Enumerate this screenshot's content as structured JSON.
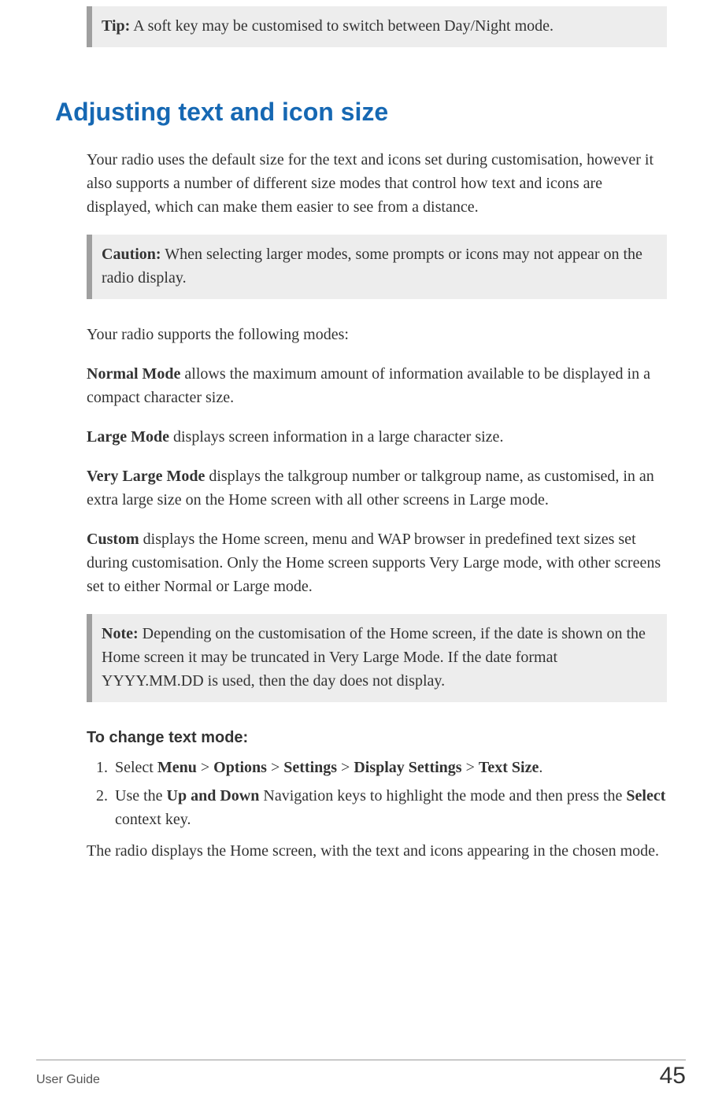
{
  "tip": {
    "label": "Tip:",
    "text": "A soft key may be customised to switch between Day/Night mode."
  },
  "heading": "Adjusting text and icon size",
  "intro": "Your radio uses the default size for the text and icons set during customisation, however it also supports a number of different size modes that control how text and icons are displayed, which can make them easier to see from a distance.",
  "caution": {
    "label": "Caution:",
    "text": "When selecting larger modes, some prompts or icons may not appear on the radio display."
  },
  "modes_intro": "Your radio supports the following modes:",
  "modes": {
    "normal": {
      "name": "Normal Mode",
      "rest": " allows the maximum amount of information available to be displayed in a compact character size."
    },
    "large": {
      "name": "Large Mode",
      "rest": " displays screen information in a large character size."
    },
    "very_large": {
      "name": "Very Large Mode",
      "rest": " displays the talkgroup number or talkgroup name, as customised, in an extra large size on the Home screen with all other screens in Large mode."
    },
    "custom": {
      "name": "Custom",
      "rest": " displays the Home screen, menu and WAP browser in predefined text sizes set during customisation. Only the Home screen supports Very Large mode, with other screens set to either Normal or Large mode."
    }
  },
  "note": {
    "label": "Note:",
    "text": "Depending on the customisation of the Home screen, if the date is shown on the Home screen it may be truncated in Very Large Mode. If the date format YYYY.MM.DD is used, then the day does not display."
  },
  "procedure": {
    "title": "To change text mode:",
    "step1": {
      "pre": "Select ",
      "b1": "Menu",
      "s1": " > ",
      "b2": "Options",
      "s2": " > ",
      "b3": "Settings",
      "s3": " > ",
      "b4": "Display Settings",
      "s4": " > ",
      "b5": "Text Size",
      "post": "."
    },
    "step2": {
      "pre": "Use the ",
      "b1": "Up and Down",
      "mid": " Navigation keys to highlight the mode and then press the ",
      "b2": "Select",
      "post": " context key."
    },
    "result": "The radio displays the Home screen, with the text and icons appearing in the chosen mode."
  },
  "footer": {
    "doc": "User Guide",
    "page": "45"
  }
}
